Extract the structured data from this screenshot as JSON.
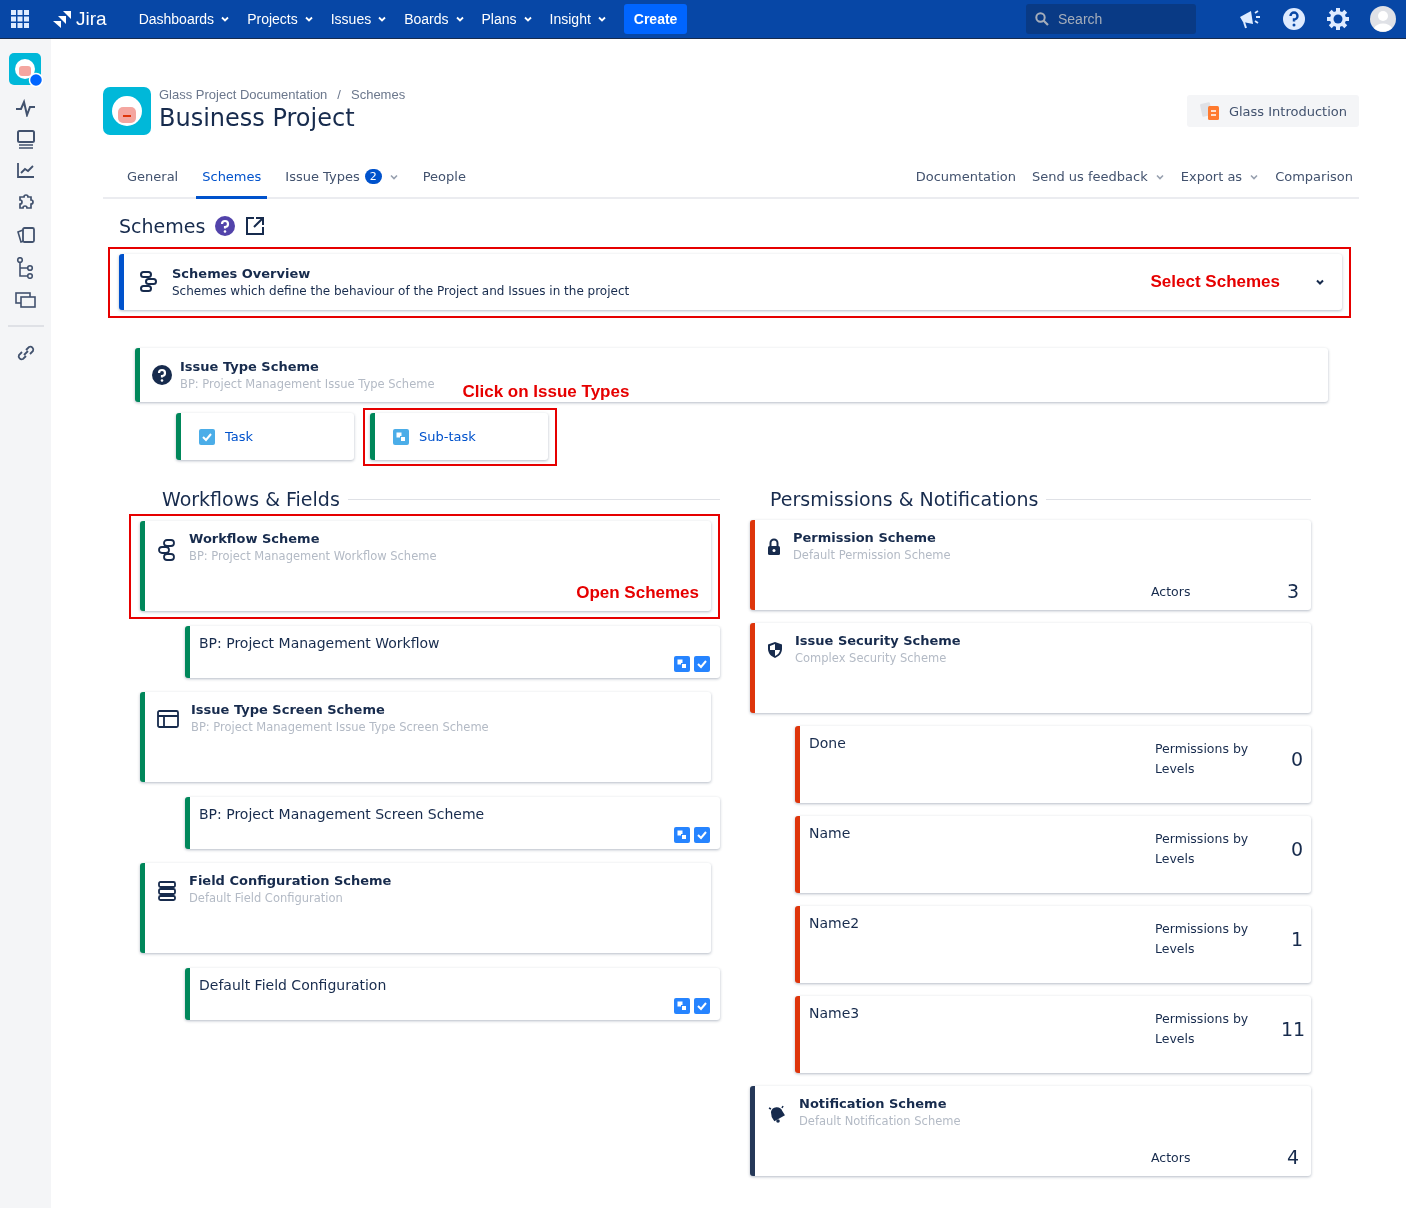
{
  "topnav": {
    "app_name": "Jira",
    "menus": [
      {
        "label": "Dashboards"
      },
      {
        "label": "Projects"
      },
      {
        "label": "Issues"
      },
      {
        "label": "Boards"
      },
      {
        "label": "Plans"
      },
      {
        "label": "Insight"
      }
    ],
    "create": "Create",
    "search": {
      "placeholder": "Search"
    }
  },
  "header": {
    "breadcrumbs": [
      "Glass Project Documentation",
      "Schemes"
    ],
    "breadcrumb_separator": "/",
    "title": "Business Project",
    "intro_button": "Glass Introduction"
  },
  "tabs": [
    {
      "label": "General",
      "selected": false
    },
    {
      "label": "Schemes",
      "selected": true
    },
    {
      "label": "Issue Types",
      "selected": false,
      "badge": "2",
      "dropdown": true
    },
    {
      "label": "People",
      "selected": false
    }
  ],
  "right_links": [
    {
      "label": "Documentation",
      "dropdown": false
    },
    {
      "label": "Send us feedback",
      "dropdown": true
    },
    {
      "label": "Export as",
      "dropdown": true
    },
    {
      "label": "Comparison",
      "dropdown": false
    }
  ],
  "section_title": "Schemes",
  "overview": {
    "title": "Schemes Overview",
    "description": "Schemes which define the behaviour of the Project and Issues in the project",
    "annotation": "Select Schemes",
    "highlighted": true
  },
  "issue_type_scheme": {
    "title": "Issue Type Scheme",
    "subtitle": "BP: Project Management Issue Type Scheme",
    "annotation": "Click on Issue Types",
    "issue_types": [
      {
        "label": "Task",
        "kind": "task",
        "highlighted": false
      },
      {
        "label": "Sub-task",
        "kind": "subtask",
        "highlighted": true
      }
    ]
  },
  "left_column": {
    "heading": "Workflows & Fields",
    "items": [
      {
        "kind": "scheme",
        "title": "Workflow Scheme",
        "subtitle": "BP: Project Management Workflow Scheme",
        "annotation": "Open Schemes",
        "highlighted": true
      },
      {
        "kind": "child",
        "label": "BP: Project Management Workflow"
      },
      {
        "kind": "scheme",
        "title": "Issue Type Screen Scheme",
        "subtitle": "BP: Project Management Issue Type Screen Scheme",
        "highlighted": false
      },
      {
        "kind": "child",
        "label": "BP: Project Management Screen Scheme"
      },
      {
        "kind": "scheme",
        "title": "Field Configuration Scheme",
        "subtitle": "Default Field Configuration",
        "highlighted": false
      },
      {
        "kind": "child",
        "label": "Default Field Configuration"
      }
    ]
  },
  "right_column": {
    "heading": "Persmissions & Notifications",
    "items": [
      {
        "kind": "scheme",
        "color": "#de350b",
        "title": "Permission Scheme",
        "subtitle": "Default Permission Scheme",
        "metric_label": "Actors",
        "metric_value": "3"
      },
      {
        "kind": "scheme",
        "color": "#de350b",
        "title": "Issue Security Scheme",
        "subtitle": "Complex Security Scheme"
      },
      {
        "kind": "child",
        "color": "#de350b",
        "label": "Done",
        "metric_label": "Permissions by Levels",
        "metric_value": "0"
      },
      {
        "kind": "child",
        "color": "#de350b",
        "label": "Name",
        "metric_label": "Permissions by Levels",
        "metric_value": "0"
      },
      {
        "kind": "child",
        "color": "#de350b",
        "label": "Name2",
        "metric_label": "Permissions by Levels",
        "metric_value": "1"
      },
      {
        "kind": "child",
        "color": "#de350b",
        "label": "Name3",
        "metric_label": "Permissions by Levels",
        "metric_value": "11"
      },
      {
        "kind": "scheme",
        "color": "#253858",
        "title": "Notification Scheme",
        "subtitle": "Default Notification Scheme",
        "metric_label": "Actors",
        "metric_value": "4"
      }
    ]
  }
}
